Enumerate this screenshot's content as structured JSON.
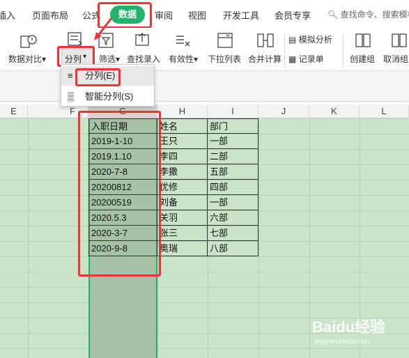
{
  "tabs": [
    "插入",
    "页面布局",
    "公式",
    "数据",
    "审阅",
    "视图",
    "开发工具",
    "会员专享"
  ],
  "search_text": "查找命令、搜索模板",
  "ribbon": {
    "data_compare": "数据对比",
    "split": "分列",
    "filter": "筛选",
    "lookup_entry": "查找录入",
    "validity": "有效性",
    "dropdown_list": "下拉列表",
    "merge_calc": "合并计算",
    "simulation": "模拟分析",
    "record_sheet": "记录单",
    "create_group": "创建组",
    "ungroup": "取消组"
  },
  "menu": {
    "split_e": "分列(E)",
    "smart_split": "智能分列(S)"
  },
  "columns": [
    "E",
    "F",
    "G",
    "H",
    "I",
    "J",
    "K",
    "L"
  ],
  "table": {
    "headers": [
      "入职日期",
      "姓名",
      "部门"
    ],
    "rows": [
      [
        "2019-1-10",
        "王只",
        "一部"
      ],
      [
        "2019.1.10",
        "李四",
        "二部"
      ],
      [
        "2020-7-8",
        "李撒",
        "五部"
      ],
      [
        "20200812",
        "优修",
        "四部"
      ],
      [
        "20200519",
        "刘备",
        "一部"
      ],
      [
        "2020.5.3",
        "关羽",
        "六部"
      ],
      [
        "2020-3-7",
        "张三",
        "七部"
      ],
      [
        "2020-9-8",
        "奥瑞",
        "八部"
      ]
    ]
  },
  "watermark": "Baidu经验",
  "watermark_url": "jingyan.baidu.com",
  "colors": {
    "accent": "#1fb36b",
    "highlight": "#ee3333",
    "sheet_bg": "#c9e4c9"
  }
}
